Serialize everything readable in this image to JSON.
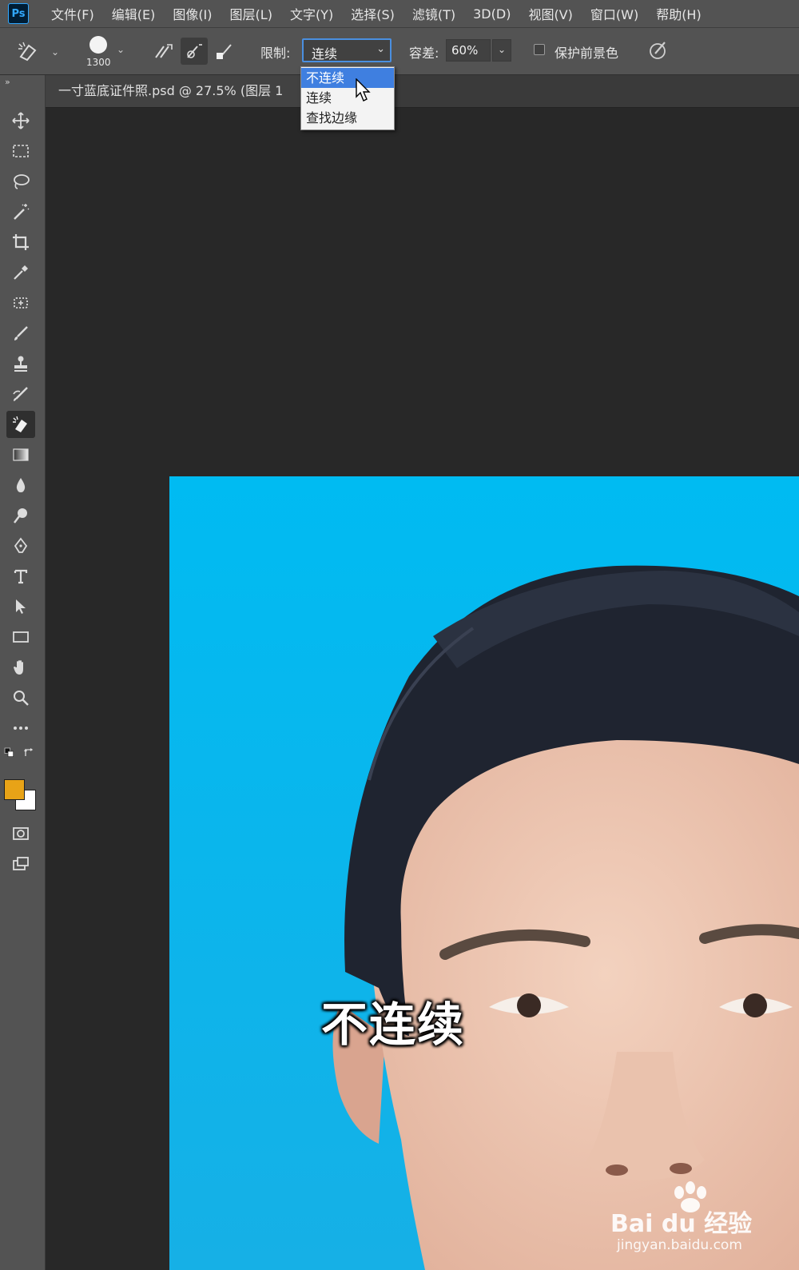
{
  "app": {
    "logo": "Ps"
  },
  "menu": [
    "文件(F)",
    "编辑(E)",
    "图像(I)",
    "图层(L)",
    "文字(Y)",
    "选择(S)",
    "滤镜(T)",
    "3D(D)",
    "视图(V)",
    "窗口(W)",
    "帮助(H)"
  ],
  "options": {
    "brush_size": "1300",
    "limit_label": "限制:",
    "limit_value": "连续",
    "tolerance_label": "容差:",
    "tolerance_value": "60%",
    "protect_label": "保护前景色"
  },
  "dropdown": {
    "items": [
      "不连续",
      "连续",
      "查找边缘"
    ],
    "selected_index": 0
  },
  "document": {
    "tab_title": "一寸蓝底证件照.psd @ 27.5% (图层 1"
  },
  "colors": {
    "foreground": "#e8a317",
    "background": "#ffffff",
    "photo_background": "#00b8f0"
  },
  "tools": [
    "move-icon",
    "marquee-icon",
    "lasso-icon",
    "magic-wand-icon",
    "crop-icon",
    "eyedropper-icon",
    "healing-icon",
    "brush-icon",
    "stamp-icon",
    "history-brush-icon",
    "background-eraser-icon",
    "gradient-icon",
    "blur-icon",
    "dodge-icon",
    "pen-icon",
    "type-icon",
    "path-select-icon",
    "rectangle-icon",
    "hand-icon",
    "zoom-icon",
    "more-tools-icon"
  ],
  "subtitle": "不连续",
  "watermark": {
    "brand": "Bai du 经验",
    "url": "jingyan.baidu.com"
  }
}
